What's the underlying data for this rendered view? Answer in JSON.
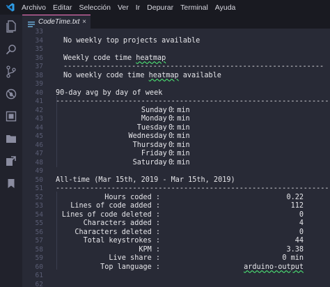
{
  "menubar": {
    "items": [
      "Archivo",
      "Editar",
      "Selección",
      "Ver",
      "Ir",
      "Depurar",
      "Terminal",
      "Ayuda"
    ]
  },
  "activitybar": {
    "icons": [
      "files-icon",
      "search-icon",
      "source-control-icon",
      "debug-icon",
      "extensions-icon",
      "folder-icon",
      "remote-explorer-icon",
      "bookmark-icon"
    ]
  },
  "tab": {
    "label": "CodeTime.txt",
    "close": "×"
  },
  "colors": {
    "accent": "#ff79c6",
    "background": "#282a36",
    "lineNumber": "#5a5d74",
    "text": "#e6e6ea",
    "squiggle": "#50fa7b"
  },
  "lines": [
    {
      "n": "33",
      "text": ""
    },
    {
      "n": "34",
      "text": "No weekly top projects available"
    },
    {
      "n": "35",
      "text": ""
    },
    {
      "n": "36",
      "text": "Weekly code time heatmap"
    },
    {
      "n": "37",
      "text": "-------------------------------------------------------------"
    },
    {
      "n": "38",
      "text": "No weekly code time heatmap available"
    },
    {
      "n": "39",
      "text": ""
    },
    {
      "n": "40",
      "text": "90-day avg by day of week"
    },
    {
      "n": "41",
      "text": "-----------------------------------------------------------------"
    },
    {
      "n": "42",
      "label": "Sunday :",
      "value": "0 min"
    },
    {
      "n": "43",
      "label": "Monday :",
      "value": "0 min"
    },
    {
      "n": "44",
      "label": "Tuesday :",
      "value": "0 min"
    },
    {
      "n": "45",
      "label": "Wednesday :",
      "value": "0 min"
    },
    {
      "n": "46",
      "label": "Thursday :",
      "value": "0 min"
    },
    {
      "n": "47",
      "label": "Friday :",
      "value": "0 min"
    },
    {
      "n": "48",
      "label": "Saturday :",
      "value": "0 min"
    },
    {
      "n": "49",
      "text": ""
    },
    {
      "n": "50",
      "text": "All-time (Mar 15th, 2019 - Mar 15th, 2019)"
    },
    {
      "n": "51",
      "text": "-----------------------------------------------------------------"
    },
    {
      "n": "52",
      "label": "Hours coded :",
      "value": "0.22"
    },
    {
      "n": "53",
      "label": "Lines of code added :",
      "value": "112"
    },
    {
      "n": "54",
      "label": "Lines of code deleted :",
      "value": "0"
    },
    {
      "n": "55",
      "label": "Characters added :",
      "value": "4"
    },
    {
      "n": "56",
      "label": "Characters deleted :",
      "value": "0"
    },
    {
      "n": "57",
      "label": "Total keystrokes :",
      "value": "44"
    },
    {
      "n": "58",
      "label": "KPM :",
      "value": "3.38"
    },
    {
      "n": "59",
      "label": "Live share :",
      "value": "0 min"
    },
    {
      "n": "60",
      "label": "Top language :",
      "value": "arduino-output"
    },
    {
      "n": "61",
      "text": ""
    },
    {
      "n": "62",
      "text": ""
    }
  ]
}
